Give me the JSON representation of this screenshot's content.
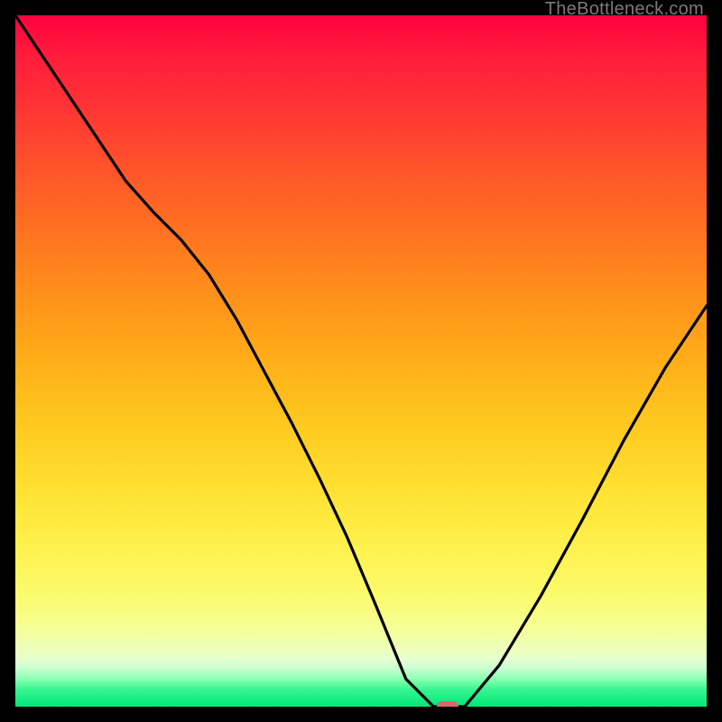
{
  "watermark": "TheBottleneck.com",
  "chart_data": {
    "type": "line",
    "title": "",
    "xlabel": "",
    "ylabel": "",
    "xlim": [
      0,
      1
    ],
    "ylim": [
      0,
      100
    ],
    "grid": false,
    "legend": false,
    "series": [
      {
        "name": "bottleneck-curve",
        "x": [
          0.0,
          0.04,
          0.08,
          0.12,
          0.16,
          0.2,
          0.24,
          0.28,
          0.32,
          0.36,
          0.4,
          0.44,
          0.48,
          0.52,
          0.565,
          0.605,
          0.65,
          0.7,
          0.76,
          0.82,
          0.88,
          0.94,
          1.0
        ],
        "y": [
          100,
          94.0,
          88.0,
          82.0,
          76.0,
          71.5,
          67.5,
          62.5,
          56.0,
          48.5,
          41.0,
          33.0,
          24.5,
          15.0,
          4.0,
          0.0,
          0.0,
          6.0,
          16.0,
          27.0,
          38.5,
          49.0,
          58.0
        ]
      }
    ],
    "annotations": [
      {
        "name": "optimal-marker",
        "x": 0.625,
        "y": 0.0
      }
    ],
    "gradient_stops": [
      {
        "pos": 0,
        "color": "#ff0240"
      },
      {
        "pos": 50,
        "color": "#ffa819"
      },
      {
        "pos": 84,
        "color": "#fbfb6e"
      },
      {
        "pos": 100,
        "color": "#00e878"
      }
    ]
  }
}
